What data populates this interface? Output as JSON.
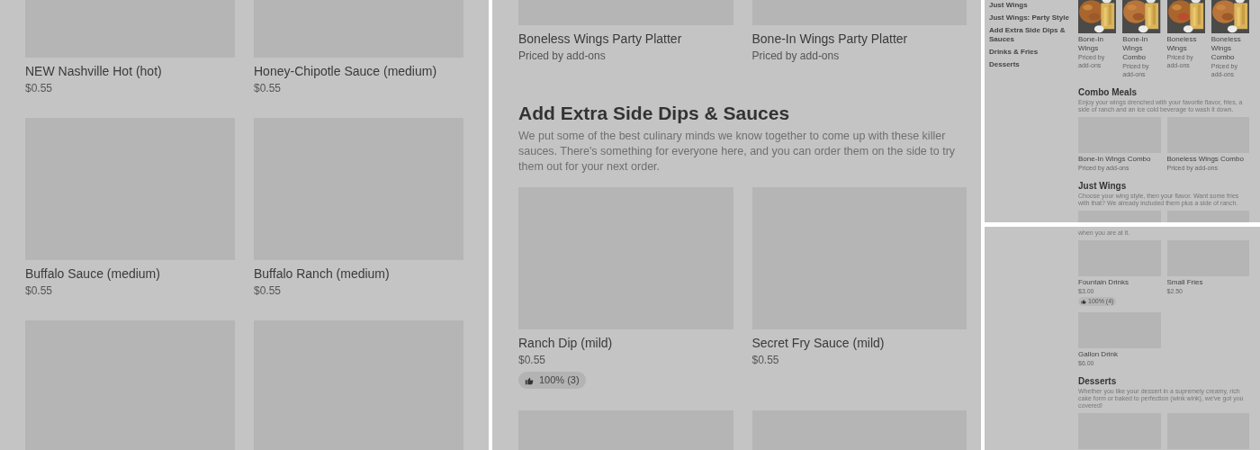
{
  "panels": [
    {
      "kind": "large",
      "sections": [
        {
          "items": [
            {
              "kind": "item",
              "name": "NEW Nashville Hot (hot)",
              "price": "$0.55"
            },
            {
              "kind": "item",
              "name": "Honey-Chipotle Sauce (medium)",
              "price": "$0.55"
            },
            {
              "kind": "item",
              "name": "Buffalo Sauce (medium)",
              "price": "$0.55"
            },
            {
              "kind": "item",
              "name": "Buffalo Ranch (medium)",
              "price": "$0.55"
            },
            {
              "kind": "image_only"
            },
            {
              "kind": "image_only"
            }
          ]
        }
      ]
    },
    {
      "kind": "large",
      "sections": [
        {
          "items": [
            {
              "kind": "item",
              "name": "Boneless Wings Party Platter",
              "price": "Priced by add-ons"
            },
            {
              "kind": "item",
              "name": "Bone-In Wings Party Platter",
              "price": "Priced by add-ons"
            }
          ]
        },
        {
          "title": "Add Extra Side Dips & Sauces",
          "description": "We put some of the best culinary minds we know together to come up with these killer sauces. There's something for everyone here, and you can order them on the side to try them out for your next order.",
          "items": [
            {
              "kind": "item",
              "name": "Ranch Dip (mild)",
              "price": "$0.55",
              "rating": "100% (3)"
            },
            {
              "kind": "item",
              "name": "Secret Fry Sauce (mild)",
              "price": "$0.55"
            },
            {
              "kind": "image_only"
            },
            {
              "kind": "image_only"
            }
          ]
        }
      ]
    },
    {
      "kind": "small",
      "sidebar": [
        "Just Wings",
        "Just Wings: Party Style",
        "Add Extra Side Dips & Sauces",
        "Drinks & Fries",
        "Desserts"
      ],
      "sections": [
        {
          "items": [
            {
              "name": "Bone-In Wings",
              "price": "Priced by add-ons"
            },
            {
              "name": "Bone-In Wings Combo",
              "price": "Priced by add-ons"
            },
            {
              "name": "Boneless Wings",
              "price": "Priced by add-ons"
            },
            {
              "name": "Boneless Wings Combo",
              "price": "Priced by add-ons"
            }
          ]
        },
        {
          "title": "Combo Meals",
          "description": "Enjoy your wings drenched with your favorite flavor, fries, a side of ranch and an ice cold beverage to wash it down.",
          "items": [
            {
              "kind": "item",
              "name": "Bone-In Wings Combo",
              "price": "Priced by add-ons"
            },
            {
              "kind": "item",
              "name": "Boneless Wings Combo",
              "price": "Priced by add-ons"
            }
          ]
        },
        {
          "title": "Just Wings",
          "description": "Choose your wing style, then your flavor. Want some fries with that? We already included them plus a side of ranch.",
          "items": [
            {
              "kind": "image_only"
            },
            {
              "kind": "image_only"
            }
          ]
        }
      ]
    },
    {
      "kind": "small",
      "sections": [
        {
          "description": "when you are at it.",
          "items": [
            {
              "kind": "item",
              "name": "Fountain Drinks",
              "price": "$3.00",
              "rating": "100% (4)"
            },
            {
              "kind": "item",
              "name": "Small Fries",
              "price": "$2.50"
            },
            {
              "kind": "item",
              "name": "Gallon Drink",
              "price": "$6.00"
            }
          ]
        },
        {
          "title": "Desserts",
          "description": "Whether you like your dessert in a supremely creamy, rich cake form or baked to perfection (wink wink), we've got you covered!",
          "items": [
            {
              "kind": "image_only"
            },
            {
              "kind": "image_only"
            }
          ]
        }
      ]
    }
  ]
}
